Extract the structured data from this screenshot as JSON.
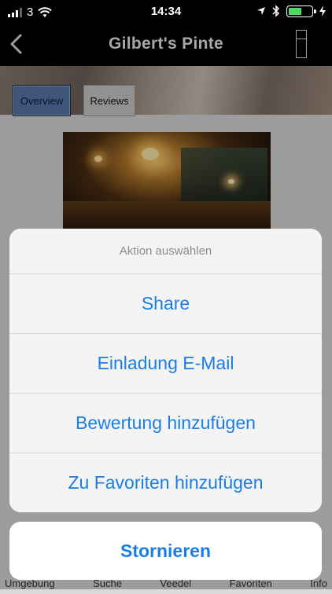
{
  "status_bar": {
    "carrier": "3",
    "time": "14:34"
  },
  "nav": {
    "title": "Gilbert's  Pinte"
  },
  "tabs": {
    "overview": "Overview",
    "reviews": "Reviews"
  },
  "action_sheet": {
    "title": "Aktion auswählen",
    "items": [
      "Share",
      "Einladung E-Mail",
      "Bewertung hinzufügen",
      "Zu Favoriten hinzufügen"
    ],
    "cancel": "Stornieren"
  },
  "tabbar": {
    "items": [
      "Umgebung",
      "Suche",
      "Veedel",
      "Favoriten",
      "Info"
    ]
  },
  "colors": {
    "accent": "#1a7ee6",
    "battery": "#4cd964"
  }
}
